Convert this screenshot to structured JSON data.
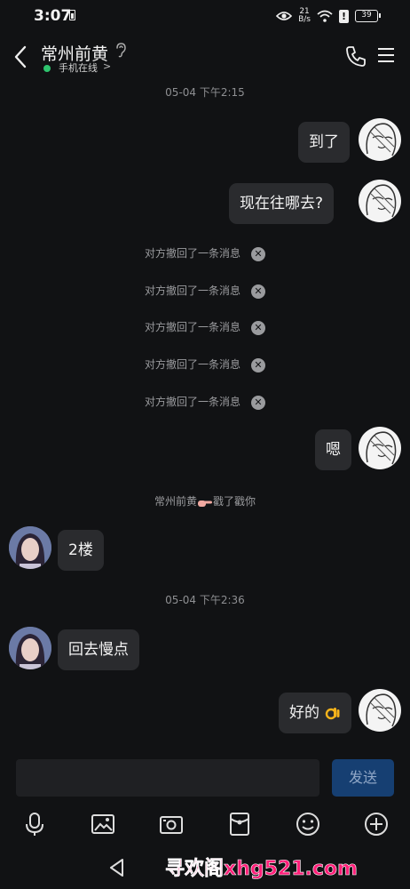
{
  "status_bar": {
    "time": "3:07",
    "net_speed_value": "21",
    "net_speed_unit": "B/s",
    "battery_level": "39"
  },
  "header": {
    "title": "常州前黄",
    "online_status": "手机在线",
    "online_chevron": ">"
  },
  "chat": {
    "timestamp_1": "05-04 下午2:15",
    "msg_1": "到了",
    "msg_2": "现在往哪去?",
    "recalls": [
      "对方撤回了一条消息",
      "对方撤回了一条消息",
      "对方撤回了一条消息",
      "对方撤回了一条消息",
      "对方撤回了一条消息"
    ],
    "msg_3": "嗯",
    "poke_sender": "常州前黄",
    "poke_action": "戳了戳你",
    "msg_4": "2楼",
    "timestamp_2": "05-04 下午2:36",
    "msg_5": "回去慢点",
    "msg_6": "好的"
  },
  "composer": {
    "input_value": "",
    "send_label": "发送"
  },
  "toolbar_icons": [
    "microphone-icon",
    "photo-icon",
    "camera-icon",
    "red-packet-icon",
    "emoji-icon",
    "plus-icon"
  ],
  "watermark": "寻欢阁xhg521.com",
  "colors": {
    "background": "#111214",
    "bubble": "#2a2b2e",
    "send_button": "#163f72",
    "online_dot": "#2ec46e",
    "watermark": "#ff1e78"
  }
}
